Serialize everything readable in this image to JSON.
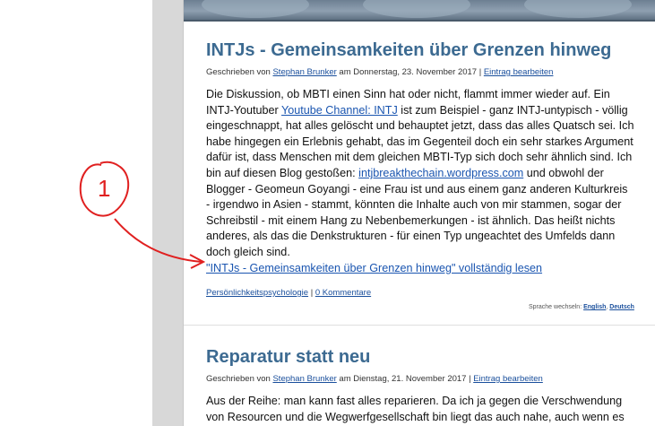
{
  "post1": {
    "title": "INTJs - Gemeinsamkeiten über Grenzen hinweg",
    "meta_prefix": "Geschrieben von ",
    "author": "Stephan Brunker",
    "meta_date": " am Donnerstag, 23. November 2017 | ",
    "edit": "Eintrag bearbeiten",
    "p1": "Die Diskussion, ob MBTI einen Sinn hat oder nicht, flammt immer wieder auf. Ein INTJ-Youtuber ",
    "link1": "Youtube Channel: INTJ",
    "p2": " ist zum Beispiel - ganz INTJ-untypisch - völlig eingeschnappt, hat alles gelöscht und behauptet jetzt, dass das alles Quatsch sei. Ich habe hingegen ein Erlebnis gehabt, das im Gegenteil doch ein sehr starkes Argument dafür ist, dass Menschen mit dem gleichen MBTI-Typ sich doch sehr ähnlich sind. Ich bin auf diesen Blog gestoßen: ",
    "link2": "intjbreakthechain.wordpress.com",
    "p3": " und obwohl der Blogger - Geomeun Goyangi - eine Frau ist und aus einem ganz anderen Kulturkreis - irgendwo in Asien - stammt, könnten die Inhalte auch von mir stammen, sogar der Schreibstil - mit einem Hang zu Nebenbemerkungen - ist ähnlich. Das heißt nichts anderes, als das die Denkstrukturen - für einen Typ ungeachtet des Umfelds dann doch gleich sind.",
    "read_more": "\"INTJs - Gemeinsamkeiten über Grenzen hinweg\" vollständig lesen",
    "category": "Persönlichkeitspsychologie",
    "comments": "0 Kommentare",
    "lang_label": "Sprache wechseln: ",
    "lang_en": "English",
    "lang_de": "Deutsch"
  },
  "post2": {
    "title": "Reparatur statt neu",
    "meta_prefix": "Geschrieben von ",
    "author": "Stephan Brunker",
    "meta_date": " am Dienstag, 21. November 2017 | ",
    "edit": "Eintrag bearbeiten",
    "text": "Aus der Reihe: man kann fast alles reparieren. Da ich ja gegen die Verschwendung von Resourcen und die Wegwerfgesellschaft bin liegt das auch nahe, auch wenn es"
  },
  "annotation": {
    "number": "1",
    "color": "#e02020"
  }
}
